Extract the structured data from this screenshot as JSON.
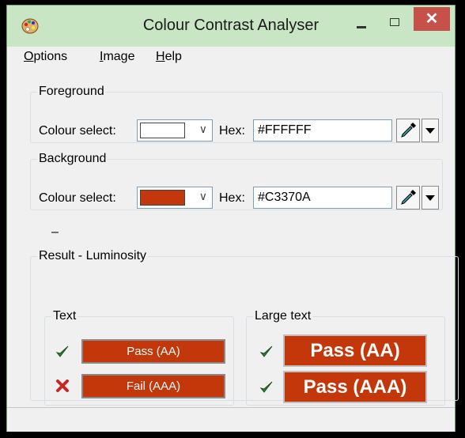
{
  "window": {
    "title": "Colour Contrast Analyser",
    "close_glyph": "✕"
  },
  "menu": {
    "options_first": "O",
    "options_rest": "ptions",
    "image_first": "I",
    "image_rest": "mage",
    "help_first": "H",
    "help_rest": "elp"
  },
  "foreground": {
    "legend": "Foreground",
    "colour_select_label": "Colour select:",
    "swatch_color": "#FFFFFF",
    "hex_label": "Hex:",
    "hex_value": "#FFFFFF",
    "picker_icon": "eyedropper-icon",
    "dropdown_icon": "dropdown-arrow-icon"
  },
  "background": {
    "legend": "Background",
    "colour_select_label": "Colour select:",
    "swatch_color": "#C3370A",
    "hex_label": "Hex:",
    "hex_value": "#C3370A",
    "picker_icon": "eyedropper-icon",
    "dropdown_icon": "dropdown-arrow-icon"
  },
  "separator_dash": "–",
  "result": {
    "legend": "Result - Luminosity",
    "text": {
      "legend": "Text",
      "aa": {
        "label": "Pass (AA)",
        "status": "pass"
      },
      "aaa": {
        "label": "Fail (AAA)",
        "status": "fail"
      }
    },
    "large_text": {
      "legend": "Large text",
      "aa": {
        "label": "Pass (AA)",
        "status": "pass"
      },
      "aaa": {
        "label": "Pass (AAA)",
        "status": "pass"
      }
    }
  },
  "colors": {
    "title_bar": "#C8E6C4",
    "close_button": "#C7504A",
    "result_fill": "#C3370A",
    "pass_check": "#2E7D32",
    "fail_cross": "#C62828"
  }
}
